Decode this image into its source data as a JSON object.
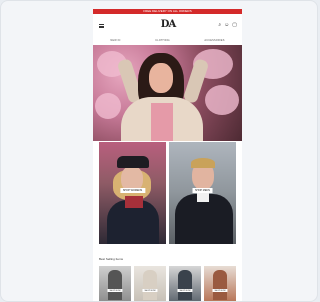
{
  "promo_bar": {
    "text": "FREE DELIVERY ON ALL ORDERS"
  },
  "header": {
    "logo": "DA",
    "icons": [
      "search-icon",
      "user-icon",
      "bag-icon"
    ]
  },
  "nav": {
    "items": [
      "NEW IN",
      "CLOTHING",
      "ACCESSORIES"
    ]
  },
  "hero": {
    "description_alt": ""
  },
  "tiles": [
    {
      "label": "SHOP WOMENS"
    },
    {
      "label": "SHOP MENS"
    }
  ],
  "section": {
    "title": "Best Selling Items"
  },
  "products": [
    {
      "label": "SHOP NOW"
    },
    {
      "label": "SHOP NOW"
    },
    {
      "label": "SHOP NOW"
    },
    {
      "label": "SHOP NOW"
    }
  ],
  "colors": {
    "promo": "#d42a2a",
    "page_bg": "#e9edf2"
  }
}
